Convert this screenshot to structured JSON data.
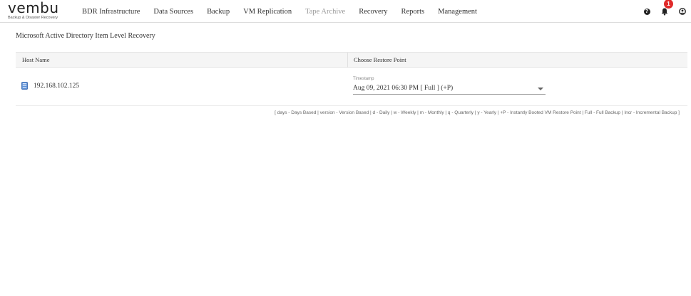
{
  "brand": {
    "name": "vembu",
    "tagline": "Backup & Disaster Recovery"
  },
  "nav": {
    "items": [
      {
        "label": "BDR Infrastructure"
      },
      {
        "label": "Data Sources"
      },
      {
        "label": "Backup"
      },
      {
        "label": "VM Replication"
      },
      {
        "label": "Tape Archive"
      },
      {
        "label": "Recovery"
      },
      {
        "label": "Reports"
      },
      {
        "label": "Management"
      }
    ]
  },
  "topbar": {
    "notification_count": "1",
    "icons": [
      "help-icon",
      "bell-icon",
      "user-icon"
    ]
  },
  "page": {
    "title": "Microsoft Active Directory Item Level Recovery"
  },
  "table": {
    "columns": [
      "Host Name",
      "Choose Restore Point"
    ],
    "rows": [
      {
        "host": "192.168.102.125",
        "timestamp_label": "Timestamp",
        "restore_point": "Aug 09, 2021 06:30 PM [ Full ] (+P)"
      }
    ]
  },
  "legend": "[ days - Days Based | version - Version Based | d - Daily | w - Weekly | m - Monthly | q - Quarterly | y - Yearly | +P - Instantly Booted VM Restore Point | Full - Full Backup | Incr - Incremental Backup ]",
  "colors": {
    "badge": "#e02a2a",
    "header_bg": "#f5f5f5",
    "disabled_text": "#9a9a9a"
  }
}
